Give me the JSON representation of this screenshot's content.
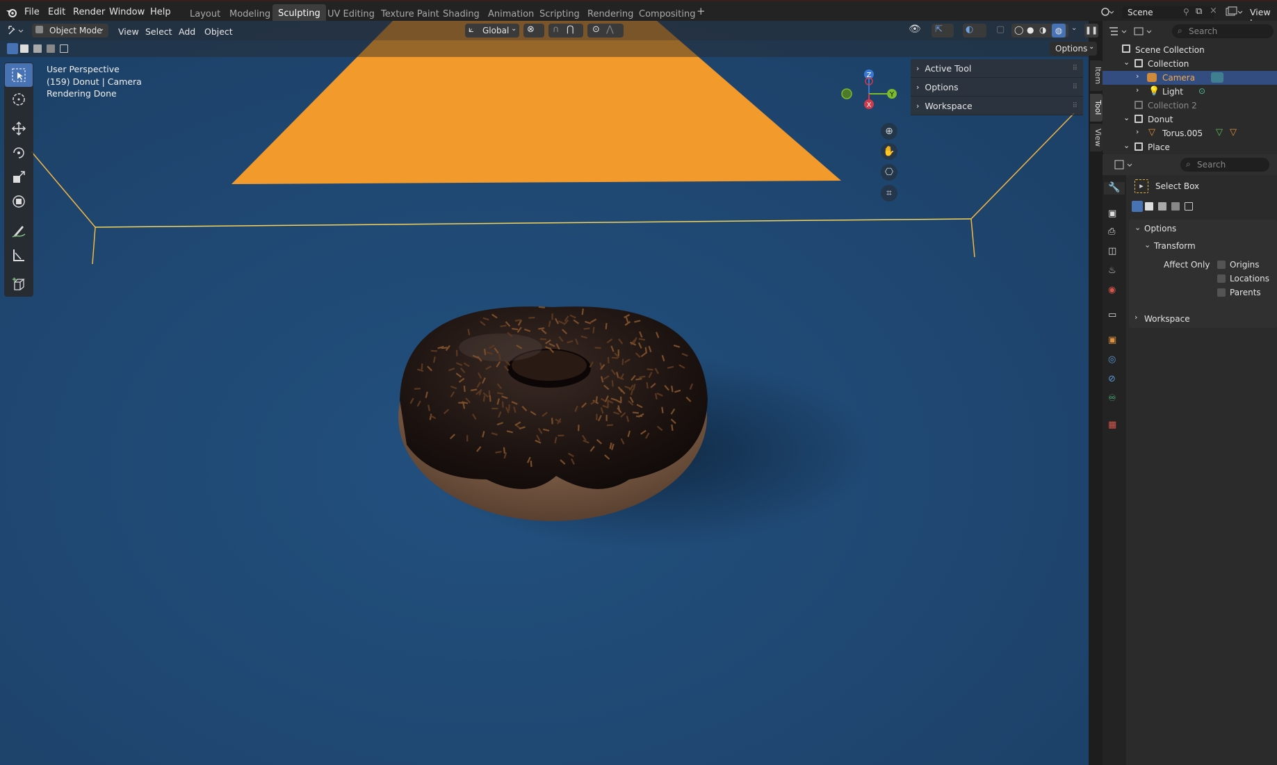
{
  "menu": {
    "file": "File",
    "edit": "Edit",
    "render": "Render",
    "window": "Window",
    "help": "Help"
  },
  "workspaces": [
    "Layout",
    "Modeling",
    "Sculpting",
    "UV Editing",
    "Texture Paint",
    "Shading",
    "Animation",
    "Scripting",
    "Rendering",
    "Compositing"
  ],
  "workspace_add": "+",
  "scene": {
    "name": "Scene",
    "view_layer": "View La"
  },
  "viewport": {
    "mode": "Object Mode",
    "menus": {
      "view": "View",
      "select": "Select",
      "add": "Add",
      "object": "Object"
    },
    "transform_orientation": "Global",
    "options": "Options",
    "info": {
      "perspective": "User Perspective",
      "object": "(159) Donut | Camera",
      "status": "Rendering Done"
    },
    "gizmo": {
      "x": "X",
      "y": "Y",
      "z": "Z"
    }
  },
  "npanel": {
    "active_tool": "Active Tool",
    "options": "Options",
    "workspace": "Workspace"
  },
  "sidetabs": {
    "item": "Item",
    "tool": "Tool",
    "view": "View"
  },
  "outliner": {
    "search_placeholder": "Search",
    "rows": [
      {
        "label": "Scene Collection"
      },
      {
        "label": "Collection"
      },
      {
        "label": "Camera"
      },
      {
        "label": "Light"
      },
      {
        "label": "Collection 2"
      },
      {
        "label": "Donut"
      },
      {
        "label": "Torus.005"
      },
      {
        "label": "Place"
      }
    ]
  },
  "properties": {
    "search_placeholder": "Search",
    "tool_name": "Select Box",
    "options_label": "Options",
    "transform_label": "Transform",
    "affect_only": "Affect Only",
    "origins": "Origins",
    "locations": "Locations",
    "parents": "Parents",
    "workspace": "Workspace"
  },
  "colors": {
    "accent": "#4772b3",
    "viewport_bg": "#1f4670",
    "camera_frame": "#f29a2b",
    "selection": "#334d80"
  }
}
